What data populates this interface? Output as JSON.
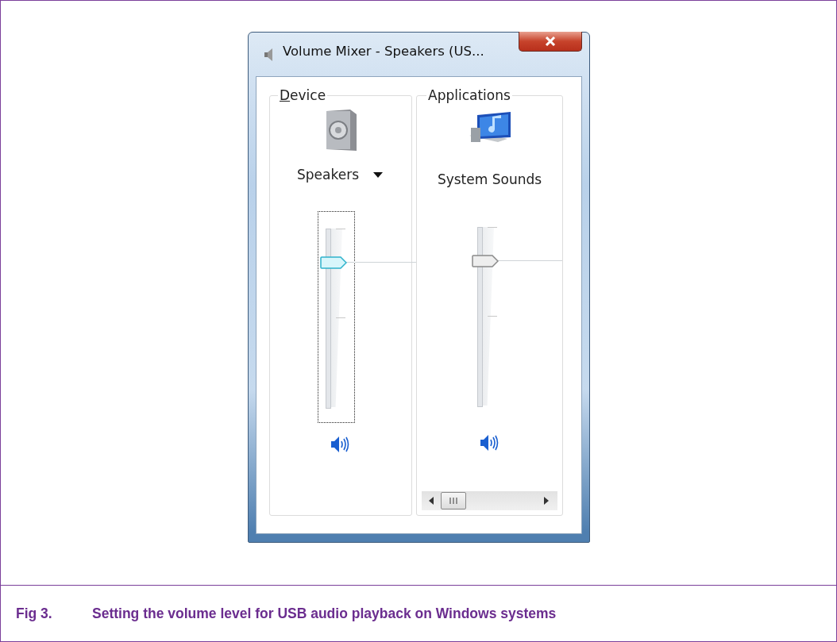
{
  "window": {
    "title": "Volume Mixer - Speakers (US..."
  },
  "groups": [
    {
      "label": "Device",
      "access_key_underlined": true,
      "channel": {
        "kind": "device",
        "name": "Speakers",
        "focused": true,
        "level": 0.81,
        "muted": false
      },
      "scrollbar": false
    },
    {
      "label": "Applications",
      "access_key_underlined": false,
      "channel": {
        "kind": "application",
        "name": "System Sounds",
        "focused": false,
        "level": 0.81,
        "muted": false
      },
      "scrollbar": true
    }
  ],
  "caption": {
    "number": "Fig 3.",
    "text": "Setting the volume level for USB audio playback on Windows systems"
  }
}
